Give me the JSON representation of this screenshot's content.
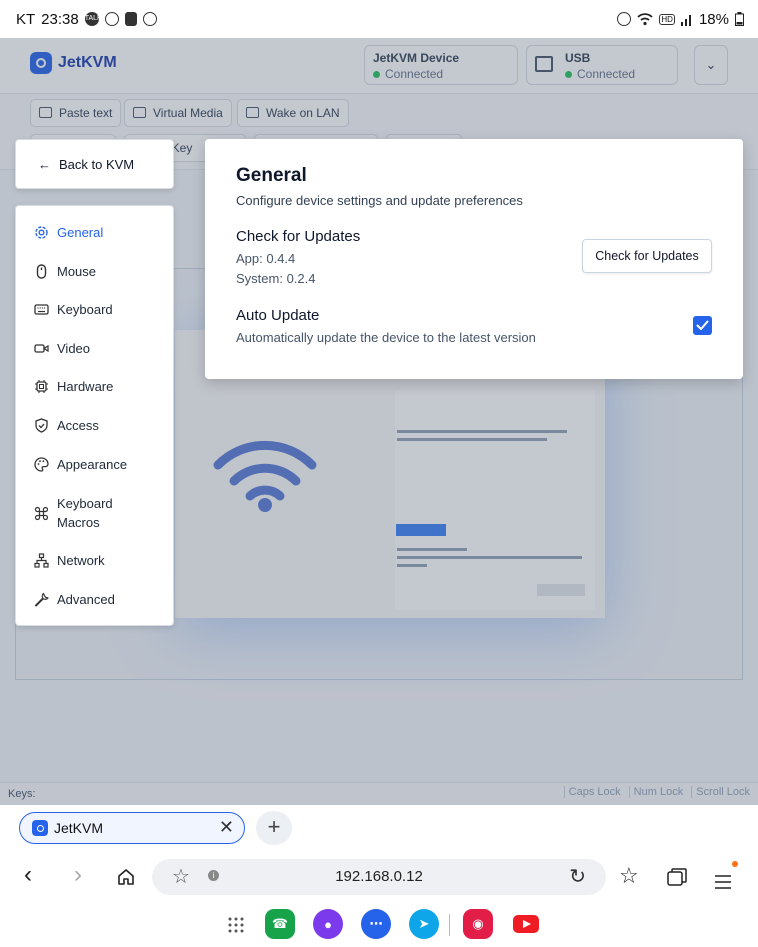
{
  "status_bar": {
    "carrier": "KT",
    "time": "23:38",
    "talk_badge": "TALK",
    "hd": "HD",
    "battery": "18%"
  },
  "app": {
    "logo_text": "JetKVM",
    "connections": [
      {
        "title": "JetKVM Device",
        "status": "Connected"
      },
      {
        "title": "USB",
        "status": "Connected"
      }
    ],
    "toolbar": [
      "Paste text",
      "Virtual Media",
      "Wake on LAN"
    ],
    "toolbar_partial": "al Key",
    "keys_label": "Keys:",
    "locks": [
      "Caps Lock",
      "Num Lock",
      "Scroll Lock"
    ]
  },
  "settings": {
    "back_label": "Back to KVM",
    "nav": [
      {
        "label": "General",
        "icon": "gear-icon",
        "active": true
      },
      {
        "label": "Mouse",
        "icon": "mouse-icon"
      },
      {
        "label": "Keyboard",
        "icon": "keyboard-icon"
      },
      {
        "label": "Video",
        "icon": "video-icon"
      },
      {
        "label": "Hardware",
        "icon": "cpu-icon"
      },
      {
        "label": "Access",
        "icon": "shield-check-icon"
      },
      {
        "label": "Appearance",
        "icon": "palette-icon"
      },
      {
        "label": "Keyboard Macros",
        "icon": "command-icon"
      },
      {
        "label": "Network",
        "icon": "network-icon"
      },
      {
        "label": "Advanced",
        "icon": "wrench-icon"
      }
    ],
    "general": {
      "title": "General",
      "subtitle": "Configure device settings and update preferences",
      "updates_heading": "Check for Updates",
      "app_version": "App: 0.4.4",
      "system_version": "System: 0.2.4",
      "check_button": "Check for Updates",
      "auto_update_heading": "Auto Update",
      "auto_update_desc": "Automatically update the device to the latest version",
      "auto_update_checked": true
    }
  },
  "browser": {
    "tab_title": "JetKVM",
    "url": "192.168.0.12"
  },
  "colors": {
    "accent": "#2563eb",
    "connected": "#22c55e"
  }
}
